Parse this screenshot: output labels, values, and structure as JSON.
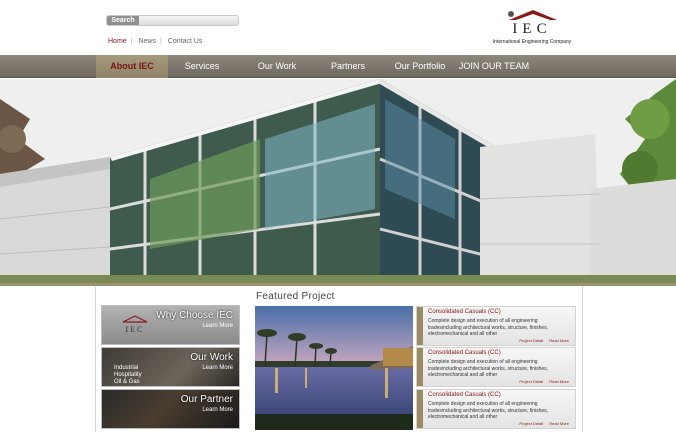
{
  "header": {
    "search_label": "Search",
    "search_value": "",
    "toplinks": [
      "Home",
      "News",
      "Contact Us"
    ],
    "logo_text": "IEC",
    "logo_sub": "International Engineering Company"
  },
  "nav": {
    "items": [
      "About IEC",
      "Services",
      "Our Work",
      "Partners",
      "Our Portfolio",
      "JOIN OUR TEAM"
    ],
    "active_index": 0
  },
  "promos": [
    {
      "title": "Why Choose IEC",
      "more": "Learn More",
      "note": ""
    },
    {
      "title": "Our Work",
      "more": "Learn More",
      "note": "Industrial\nHospitality\nOil & Gas"
    },
    {
      "title": "Our Partner",
      "more": "Learn More",
      "note": ""
    }
  ],
  "featured": {
    "title": "Featured Project",
    "projects": [
      {
        "title": "Consolidated Casuals (CC)",
        "desc": "Complete design and execution of all engineering tradesincluding architectural works, structure, finishes, electromechanical and all other",
        "detail": "Project Detail",
        "more": "Read More"
      },
      {
        "title": "Consolidated Casuals (CC)",
        "desc": "Complete design and execution of all engineering tradesincluding architectural works, structure, finishes, electromechanical and all other",
        "detail": "Project Detail",
        "more": "Read More"
      },
      {
        "title": "Consolidated Casuals (CC)",
        "desc": "Complete design and execution of all engineering tradesincluding architectural works, structure, finishes, electromechanical and all other",
        "detail": "Project Detail",
        "more": "Read More"
      }
    ]
  },
  "colors": {
    "accent": "#8a1414",
    "nav_bg": "#7d776c",
    "nav_active": "#9a8d72"
  }
}
